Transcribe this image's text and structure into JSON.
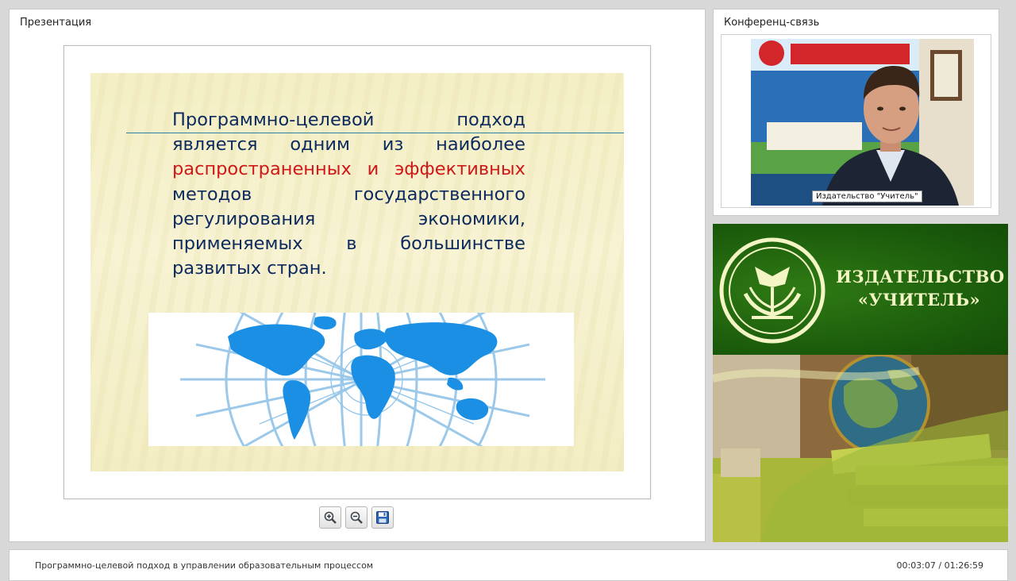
{
  "presentation_panel": {
    "title": "Презентация"
  },
  "slide": {
    "lines": [
      [
        "Программно-целевой",
        "подход"
      ],
      [
        "является",
        "одним",
        "из",
        "наиболее"
      ],
      [
        "распространенных",
        "и",
        "эффективных"
      ],
      [
        "методов",
        "государственного"
      ],
      [
        "регулирования",
        "экономики,"
      ],
      [
        "применяемых",
        "в",
        "большинстве"
      ],
      [
        "развитых стран."
      ]
    ],
    "highlight_line_index": 2,
    "text_color": "#0d2a5e",
    "highlight_color": "#d01818",
    "image": "world-map-globe"
  },
  "toolbar": {
    "buttons": [
      {
        "name": "zoom-in-button",
        "icon": "zoom-in-icon"
      },
      {
        "name": "zoom-out-button",
        "icon": "zoom-out-icon"
      },
      {
        "name": "save-button",
        "icon": "floppy-disk-icon"
      }
    ]
  },
  "conference_panel": {
    "title": "Конференц-связь",
    "video_label": "Издательство \"Учитель\""
  },
  "publisher_banner": {
    "name_line1": "ИЗДАТЕЛЬСТВО",
    "name_line2": "«УЧИТЕЛЬ»",
    "logo": "book-logo-icon",
    "brand_color": "#1f6610"
  },
  "footer": {
    "lecture_title": "Программно-целевой подход в управлении образовательным процессом",
    "timecode": "00:03:07 / 01:26:59"
  }
}
